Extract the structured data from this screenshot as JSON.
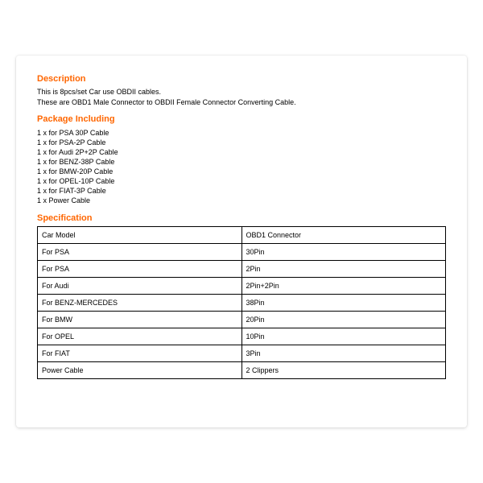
{
  "description": {
    "heading": "Description",
    "line1": "This is 8pcs/set Car use OBDII cables.",
    "line2": "These are OBD1 Male Connector to OBDII Female Connector Converting Cable."
  },
  "package": {
    "heading": "Package Including",
    "items": [
      "1 x for PSA 30P Cable",
      "1 x for PSA-2P Cable",
      "1 x for Audi 2P+2P Cable",
      "1 x for BENZ-38P Cable",
      "1 x for BMW-20P Cable",
      "1 x for OPEL-10P Cable",
      "1 x for FIAT-3P Cable",
      "1 x Power Cable"
    ]
  },
  "spec": {
    "heading": "Specification",
    "rows": [
      {
        "c1": "Car Model",
        "c2": "OBD1 Connector"
      },
      {
        "c1": "For PSA",
        "c2": "30Pin"
      },
      {
        "c1": "For PSA",
        "c2": "2Pin"
      },
      {
        "c1": "For Audi",
        "c2": "2Pin+2Pin"
      },
      {
        "c1": "For BENZ-MERCEDES",
        "c2": "38Pin"
      },
      {
        "c1": "For BMW",
        "c2": "20Pin"
      },
      {
        "c1": "For OPEL",
        "c2": "10Pin"
      },
      {
        "c1": "For FIAT",
        "c2": "3Pin"
      },
      {
        "c1": "Power Cable",
        "c2": "2 Clippers"
      }
    ]
  }
}
